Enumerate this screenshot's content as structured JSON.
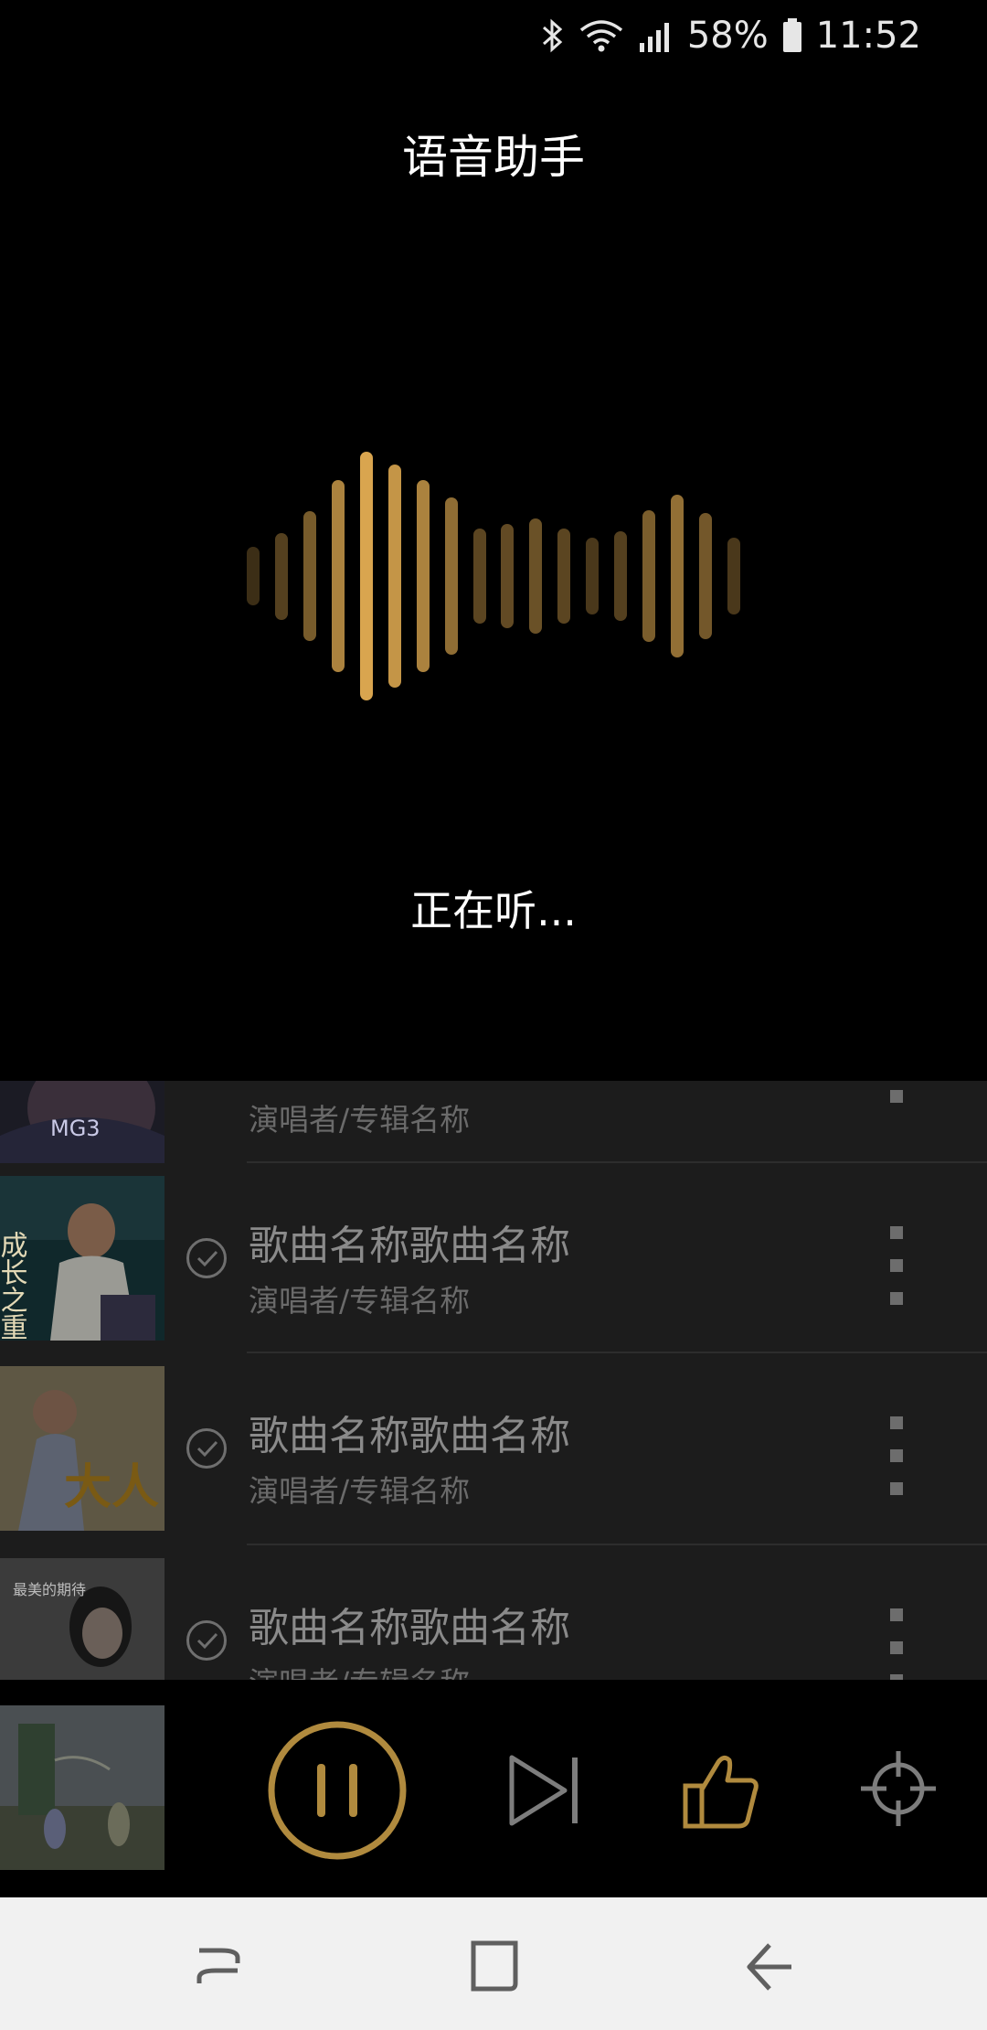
{
  "status_bar": {
    "battery_percent": "58%",
    "time": "11:52",
    "icons": [
      "bluetooth-icon",
      "wifi-icon",
      "signal-icon",
      "battery-icon"
    ]
  },
  "voice_assistant": {
    "title": "语音助手",
    "status": "正在听...",
    "colors": {
      "accent": "#d9a54f",
      "background": "#000000"
    },
    "waveform_levels": [
      0.12,
      0.25,
      0.45,
      0.74,
      1.0,
      0.88,
      0.74,
      0.58,
      0.29,
      0.33,
      0.38,
      0.29,
      0.2,
      0.26,
      0.46,
      0.6,
      0.43,
      0.2
    ]
  },
  "song_list": {
    "items": [
      {
        "title": "",
        "subtitle": "演唱者/专辑名称",
        "cover_text": "MG3"
      },
      {
        "title": "歌曲名称歌曲名称",
        "subtitle": "演唱者/专辑名称",
        "cover_text": "成长之重量"
      },
      {
        "title": "歌曲名称歌曲名称",
        "subtitle": "演唱者/专辑名称",
        "cover_text": "大人"
      },
      {
        "title": "歌曲名称歌曲名称",
        "subtitle": "演唱者/专辑名称",
        "cover_text": "最美的期待"
      }
    ]
  },
  "player": {
    "controls": [
      "pause-button",
      "next-button",
      "like-button",
      "locate-button"
    ],
    "accent": "#b08a3e"
  },
  "nav_bar": {
    "buttons": [
      "recent-apps-button",
      "home-button",
      "back-button"
    ]
  }
}
